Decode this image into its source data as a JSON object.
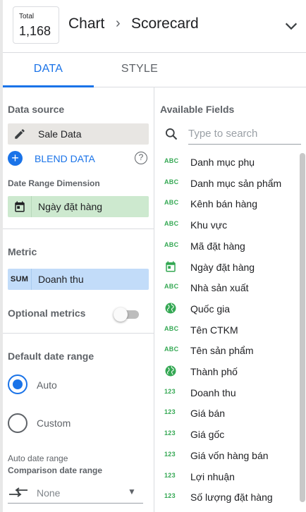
{
  "header": {
    "total_label": "Total",
    "total_value": "1,168",
    "breadcrumb_chart": "Chart",
    "breadcrumb_separator": "›",
    "breadcrumb_current": "Scorecard",
    "collapse_icon": "chevron-down-icon"
  },
  "tabs": [
    {
      "label": "DATA",
      "active": true
    },
    {
      "label": "STYLE",
      "active": false
    }
  ],
  "left": {
    "data_source_title": "Data source",
    "data_source_value": "Sale Data",
    "blend_label": "BLEND DATA",
    "help_glyph": "?",
    "date_range_dimension_title": "Date Range Dimension",
    "date_range_dimension_value": "Ngày đặt hàng",
    "metric_title": "Metric",
    "metric_tag": "SUM",
    "metric_value": "Doanh thu",
    "optional_metrics_label": "Optional metrics",
    "optional_metrics_on": false,
    "default_date_range_title": "Default date range",
    "radio_auto": "Auto",
    "radio_custom": "Custom",
    "selected_date_range": "Auto",
    "auto_date_range_note": "Auto date range",
    "comparison_title": "Comparison date range",
    "comparison_value": "None"
  },
  "right": {
    "title": "Available Fields",
    "search_placeholder": "Type to search",
    "fields": [
      {
        "type": "ABC",
        "icon": "text-field-icon",
        "name": "Danh mục phụ"
      },
      {
        "type": "ABC",
        "icon": "text-field-icon",
        "name": "Danh mục sản phẩm"
      },
      {
        "type": "ABC",
        "icon": "text-field-icon",
        "name": "Kênh bán hàng"
      },
      {
        "type": "ABC",
        "icon": "text-field-icon",
        "name": "Khu vực"
      },
      {
        "type": "ABC",
        "icon": "text-field-icon",
        "name": "Mã đặt hàng"
      },
      {
        "type": "",
        "icon": "calendar-icon",
        "name": "Ngày đặt hàng"
      },
      {
        "type": "ABC",
        "icon": "text-field-icon",
        "name": "Nhà sản xuất"
      },
      {
        "type": "",
        "icon": "globe-icon",
        "name": "Quốc gia"
      },
      {
        "type": "ABC",
        "icon": "text-field-icon",
        "name": "Tên CTKM"
      },
      {
        "type": "ABC",
        "icon": "text-field-icon",
        "name": "Tên sản phẩm"
      },
      {
        "type": "",
        "icon": "globe-icon",
        "name": "Thành phố"
      },
      {
        "type": "123",
        "icon": "number-field-icon",
        "name": "Doanh thu"
      },
      {
        "type": "123",
        "icon": "number-field-icon",
        "name": "Giá bán"
      },
      {
        "type": "123",
        "icon": "number-field-icon",
        "name": "Giá gốc"
      },
      {
        "type": "123",
        "icon": "number-field-icon",
        "name": "Giá vốn hàng bán"
      },
      {
        "type": "123",
        "icon": "number-field-icon",
        "name": "Lợi nhuận"
      },
      {
        "type": "123",
        "icon": "number-field-icon",
        "name": "Số lượng đặt hàng"
      }
    ]
  },
  "colors": {
    "accent": "#1a73e8",
    "dimension_chip": "#cde9cf",
    "metric_chip": "#c2dcf9",
    "source_chip": "#e8e6e3",
    "field_type_green": "#34a853"
  }
}
